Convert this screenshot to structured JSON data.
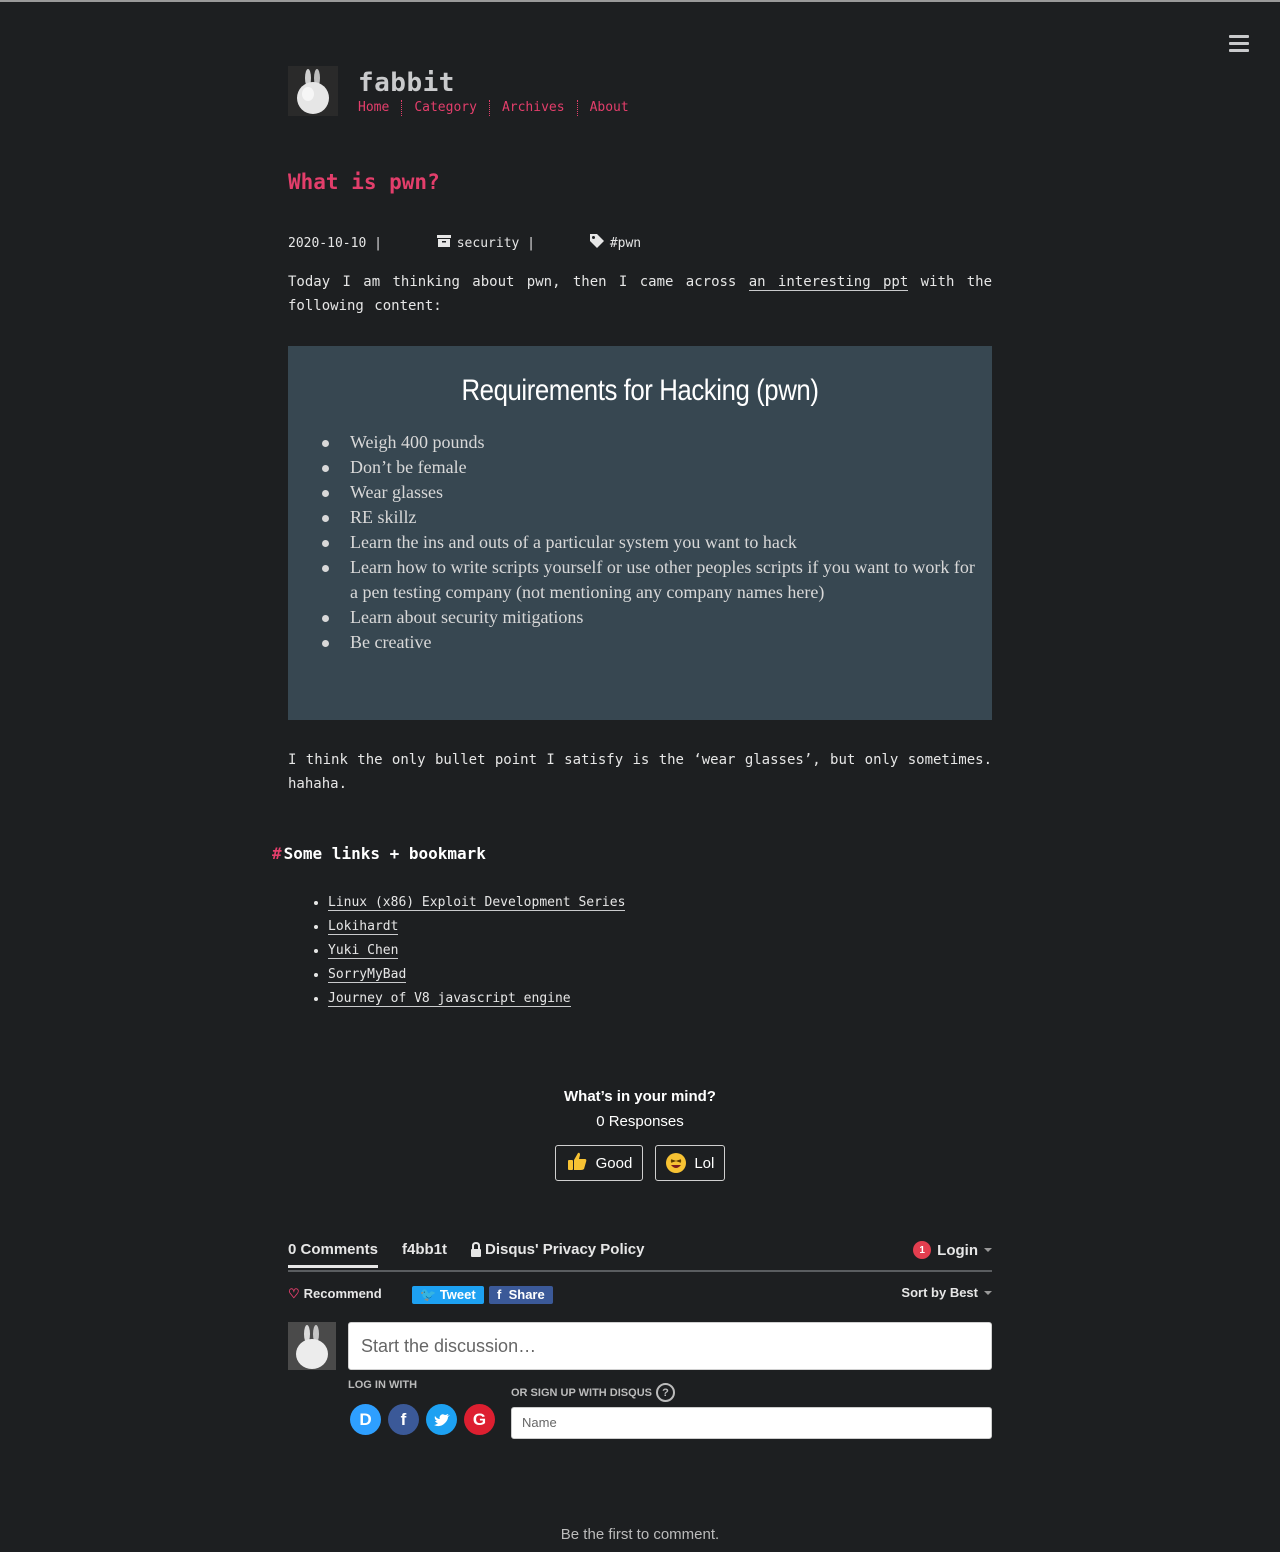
{
  "site": {
    "title": "fabbit",
    "nav": [
      "Home",
      "Category",
      "Archives",
      "About"
    ]
  },
  "post": {
    "title": "What is pwn?",
    "date": "2020-10-10",
    "category": "security",
    "tag": "#pwn",
    "intro_before": "Today I am thinking about pwn, then I came across ",
    "intro_link": "an interesting ppt",
    "intro_after": " with the following content:",
    "slide": {
      "title": "Requirements for Hacking (pwn)",
      "items": [
        "Weigh 400 pounds",
        "Don’t be female",
        "Wear glasses",
        "RE skillz",
        "Learn the ins and outs of a particular system you want to hack",
        "Learn how to write scripts yourself or use other peoples scripts if you want to work for a pen testing company (not mentioning any company names here)",
        "Learn about security mitigations",
        "Be creative"
      ]
    },
    "outro": "I think the only bullet point I satisfy is the ‘wear glasses’, but only sometimes. hahaha.",
    "section_heading": "Some links + bookmark",
    "links": [
      "Linux (x86) Exploit Development Series",
      "Lokihardt",
      "Yuki Chen",
      "SorryMyBad",
      "Journey of V8 javascript engine"
    ]
  },
  "reactions": {
    "question": "What’s in your mind?",
    "responses": "0 Responses",
    "good": "Good",
    "lol": "Lol"
  },
  "disqus": {
    "comments_tab": "0 Comments",
    "site_tab": "f4bb1t",
    "privacy": "Disqus' Privacy Policy",
    "login": "Login",
    "login_badge": "1",
    "recommend": "Recommend",
    "tweet": "Tweet",
    "share": "Share",
    "sort": "Sort by Best",
    "placeholder": "Start the discussion…",
    "log_in_with": "LOG IN WITH",
    "or_sign_up": "OR SIGN UP WITH DISQUS",
    "name_placeholder": "Name",
    "first_comment": "Be the first to comment."
  },
  "colors": {
    "accent": "#e33e6b",
    "background": "#1d1f21",
    "slide_bg": "#374751"
  }
}
